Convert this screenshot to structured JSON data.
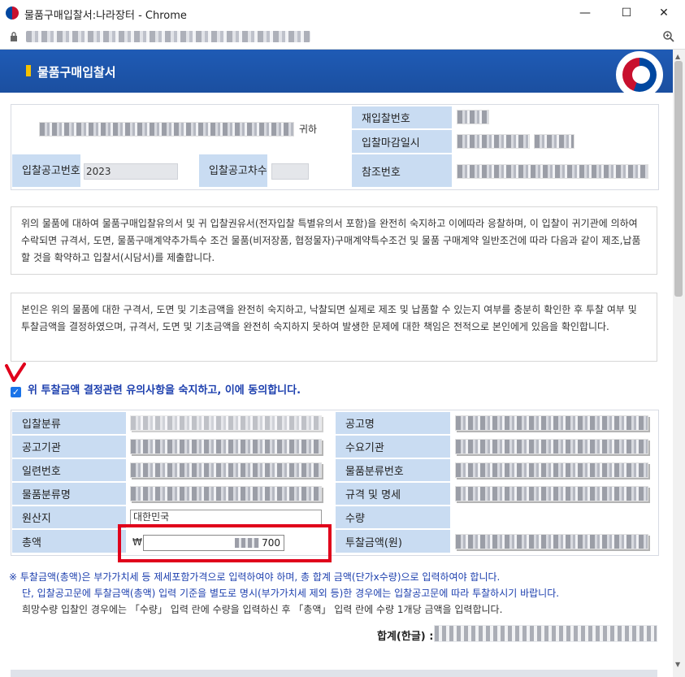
{
  "window": {
    "title": "물품구매입찰서:나라장터 - Chrome",
    "minimize": "—",
    "maximize": "☐",
    "close": "✕"
  },
  "header": {
    "title": "물품구매입찰서"
  },
  "top_table": {
    "honorific": "귀하",
    "rebid_no_label": "재입찰번호",
    "bid_deadline_label": "입찰마감일시",
    "notice_no_label": "입찰공고번호",
    "notice_no_value": "2023",
    "notice_seq_label": "입찰공고차수",
    "ref_no_label": "참조번호"
  },
  "notice1": "위의 물품에 대하여 물품구매입찰유의서 및 귀 입찰권유서(전자입찰 특별유의서 포함)을 완전히 숙지하고 이에따라 응찰하며, 이 입찰이 귀기관에 의하여 수락되면 규격서, 도면, 물품구매계약추가특수 조건 물품(비저장품, 협정물자)구매계약특수조건 및 물품 구매계약 일반조건에 따라 다음과 같이 제조,납품할 것을 확약하고 입찰서(시담서)를 제출합니다.",
  "notice2": "본인은 위의 물품에 대한 구격서, 도면 및 기초금액을 완전히 숙지하고, 낙찰되면 실제로 제조 및 납품할 수 있는지 여부를 충분히 확인한 후 투찰 여부 및 투찰금액을 결정하였으며, 규격서, 도면 및 기초금액을 완전히 숙지하지 못하여 발생한 문제에 대한 책임은 전적으로 본인에게 있음을 확인합니다.",
  "agree": {
    "checked": true,
    "label": "위 투찰금액 결정관련 유의사항을 숙지하고, 이에 동의합니다."
  },
  "detail_table": {
    "bid_category_label": "입찰분류",
    "notice_name_label": "공고명",
    "notice_agency_label": "공고기관",
    "demand_agency_label": "수요기관",
    "serial_no_label": "일련번호",
    "item_class_no_label": "물품분류번호",
    "item_class_name_label": "물품분류명",
    "spec_label": "규격 및 명세",
    "origin_label": "원산지",
    "origin_value": "대한민국",
    "quantity_label": "수량",
    "total_label": "총액",
    "currency": "₩",
    "total_value_tail": "700",
    "bid_amount_label": "투찰금액(원)"
  },
  "notes": {
    "line1": "※ 투찰금액(총액)은 부가가치세 등 제세포함가격으로 입력하여야 하며, 총 합계 금액(단가x수량)으로 입력하여야 합니다.",
    "line2": "단, 입찰공고문에 투찰금액(총액) 입력 기준을 별도로 명시(부가가치세 제외 등)한 경우에는 입찰공고문에 따라 투찰하시기 바랍니다.",
    "line3": "희망수량 입찰인 경우에는 「수량」 입력 란에 수량을 입력하신 후 「총액」 입력 란에 수량 1개당 금액을 입력합니다."
  },
  "sum": {
    "label": "합계(한글) :"
  },
  "colors": {
    "header_blue": "#1f5bb5",
    "label_bg": "#c9dcf2",
    "highlight_red": "#e0001b",
    "agree_text": "#1c3fae"
  }
}
